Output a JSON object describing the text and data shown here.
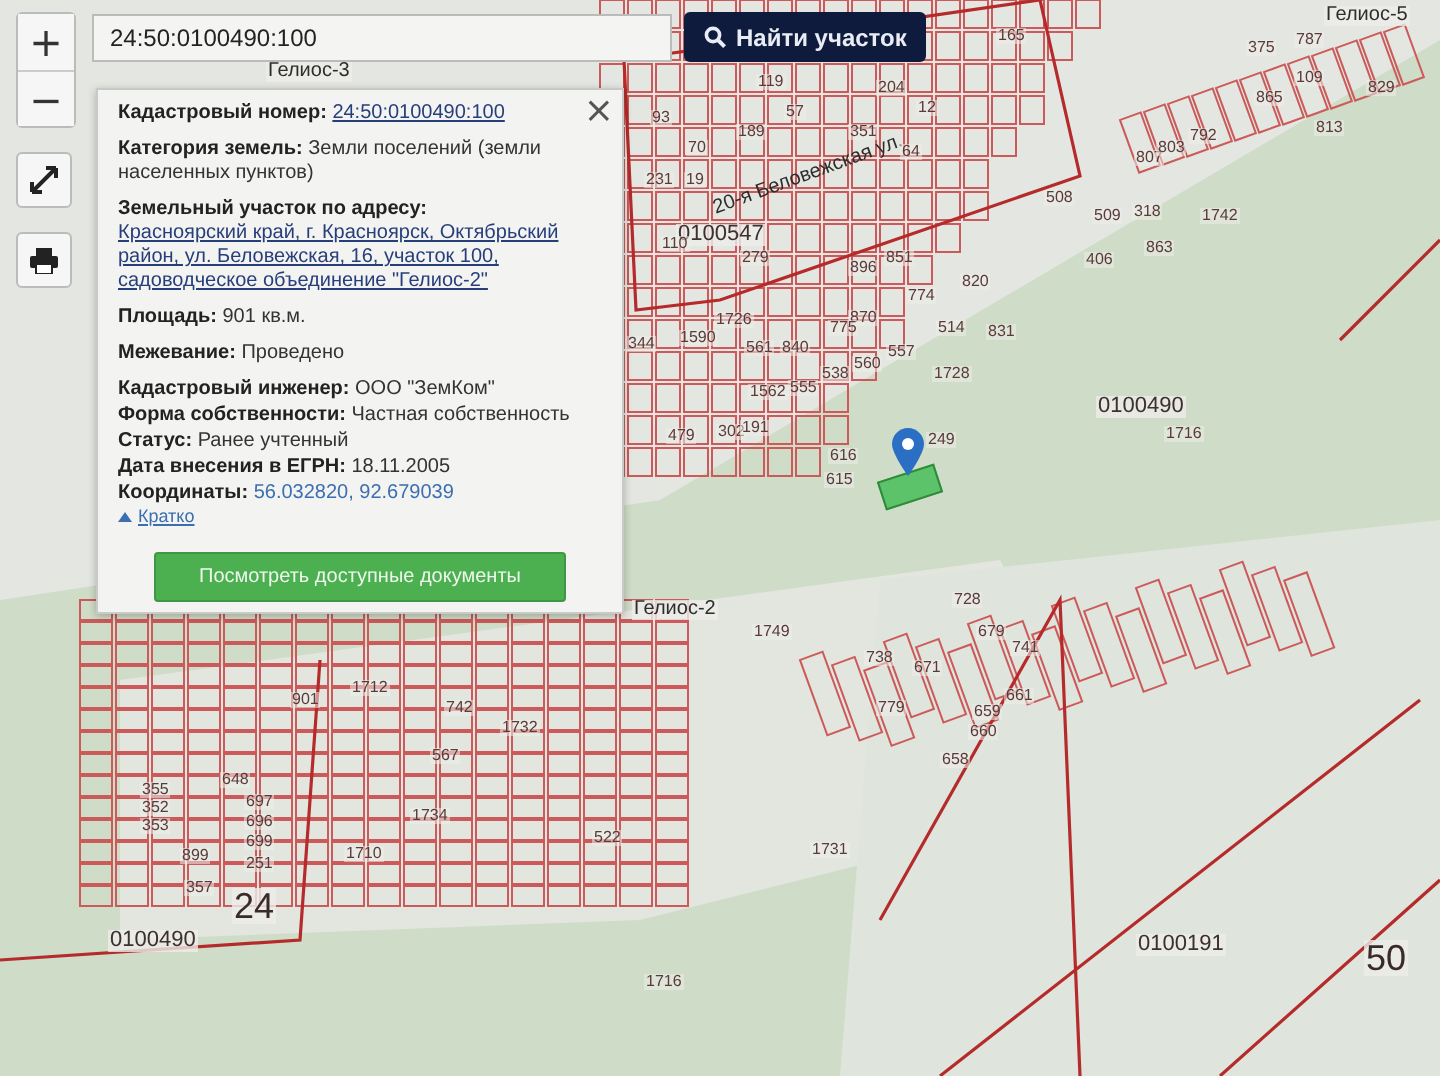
{
  "map": {
    "labels": [
      {
        "text": "Гелиос-3",
        "kind": "area"
      },
      {
        "text": "Гелиос-5",
        "kind": "area"
      },
      {
        "text": "20-я Беловежская ул.",
        "kind": "street"
      },
      {
        "text": "0100547",
        "kind": "quarter"
      },
      {
        "text": "0100490",
        "kind": "quarter"
      },
      {
        "text": "1716",
        "kind": "parcel"
      },
      {
        "text": "Гелиос-2",
        "kind": "area"
      },
      {
        "text": "24",
        "kind": "district"
      },
      {
        "text": "0100490",
        "kind": "quarter"
      },
      {
        "text": "1716",
        "kind": "parcel"
      },
      {
        "text": "0100191",
        "kind": "quarter"
      },
      {
        "text": "50",
        "kind": "district"
      },
      {
        "text": "165",
        "kind": "parcel"
      },
      {
        "text": "64",
        "kind": "parcel"
      },
      {
        "text": "508",
        "kind": "parcel"
      },
      {
        "text": "509",
        "kind": "parcel"
      },
      {
        "text": "807",
        "kind": "parcel"
      },
      {
        "text": "318",
        "kind": "parcel"
      },
      {
        "text": "803",
        "kind": "parcel"
      },
      {
        "text": "792",
        "kind": "parcel"
      },
      {
        "text": "863",
        "kind": "parcel"
      },
      {
        "text": "1742",
        "kind": "parcel"
      },
      {
        "text": "406",
        "kind": "parcel"
      },
      {
        "text": "829",
        "kind": "parcel"
      },
      {
        "text": "813",
        "kind": "parcel"
      },
      {
        "text": "865",
        "kind": "parcel"
      },
      {
        "text": "109",
        "kind": "parcel"
      },
      {
        "text": "375",
        "kind": "parcel"
      },
      {
        "text": "787",
        "kind": "parcel"
      },
      {
        "text": "514",
        "kind": "parcel"
      },
      {
        "text": "1728",
        "kind": "parcel"
      },
      {
        "text": "831",
        "kind": "parcel"
      },
      {
        "text": "774",
        "kind": "parcel"
      },
      {
        "text": "851",
        "kind": "parcel"
      },
      {
        "text": "820",
        "kind": "parcel"
      },
      {
        "text": "870",
        "kind": "parcel"
      },
      {
        "text": "775",
        "kind": "parcel"
      },
      {
        "text": "896",
        "kind": "parcel"
      },
      {
        "text": "560",
        "kind": "parcel"
      },
      {
        "text": "557",
        "kind": "parcel"
      },
      {
        "text": "538",
        "kind": "parcel"
      },
      {
        "text": "561",
        "kind": "parcel"
      },
      {
        "text": "840",
        "kind": "parcel"
      },
      {
        "text": "1562",
        "kind": "parcel"
      },
      {
        "text": "555",
        "kind": "parcel"
      },
      {
        "text": "249",
        "kind": "parcel"
      },
      {
        "text": "616",
        "kind": "parcel"
      },
      {
        "text": "615",
        "kind": "parcel"
      },
      {
        "text": "279",
        "kind": "parcel"
      },
      {
        "text": "93",
        "kind": "parcel"
      },
      {
        "text": "70",
        "kind": "parcel"
      },
      {
        "text": "231",
        "kind": "parcel"
      },
      {
        "text": "19",
        "kind": "parcel"
      },
      {
        "text": "110",
        "kind": "parcel"
      },
      {
        "text": "119",
        "kind": "parcel"
      },
      {
        "text": "189",
        "kind": "parcel"
      },
      {
        "text": "57",
        "kind": "parcel"
      },
      {
        "text": "204",
        "kind": "parcel"
      },
      {
        "text": "12",
        "kind": "parcel"
      },
      {
        "text": "351",
        "kind": "parcel"
      },
      {
        "text": "1726",
        "kind": "parcel"
      },
      {
        "text": "1590",
        "kind": "parcel"
      },
      {
        "text": "344",
        "kind": "parcel"
      },
      {
        "text": "479",
        "kind": "parcel"
      },
      {
        "text": "302",
        "kind": "parcel"
      },
      {
        "text": "191",
        "kind": "parcel"
      },
      {
        "text": "728",
        "kind": "parcel"
      },
      {
        "text": "679",
        "kind": "parcel"
      },
      {
        "text": "741",
        "kind": "parcel"
      },
      {
        "text": "738",
        "kind": "parcel"
      },
      {
        "text": "671",
        "kind": "parcel"
      },
      {
        "text": "779",
        "kind": "parcel"
      },
      {
        "text": "660",
        "kind": "parcel"
      },
      {
        "text": "659",
        "kind": "parcel"
      },
      {
        "text": "661",
        "kind": "parcel"
      },
      {
        "text": "658",
        "kind": "parcel"
      },
      {
        "text": "742",
        "kind": "parcel"
      },
      {
        "text": "1732",
        "kind": "parcel"
      },
      {
        "text": "901",
        "kind": "parcel"
      },
      {
        "text": "1712",
        "kind": "parcel"
      },
      {
        "text": "1749",
        "kind": "parcel"
      },
      {
        "text": "567",
        "kind": "parcel"
      },
      {
        "text": "1731",
        "kind": "parcel"
      },
      {
        "text": "522",
        "kind": "parcel"
      },
      {
        "text": "899",
        "kind": "parcel"
      },
      {
        "text": "697",
        "kind": "parcel"
      },
      {
        "text": "696",
        "kind": "parcel"
      },
      {
        "text": "699",
        "kind": "parcel"
      },
      {
        "text": "251",
        "kind": "parcel"
      },
      {
        "text": "355",
        "kind": "parcel"
      },
      {
        "text": "352",
        "kind": "parcel"
      },
      {
        "text": "353",
        "kind": "parcel"
      },
      {
        "text": "357",
        "kind": "parcel"
      },
      {
        "text": "648",
        "kind": "parcel"
      },
      {
        "text": "1710",
        "kind": "parcel"
      },
      {
        "text": "1734",
        "kind": "parcel"
      }
    ]
  },
  "controls": {
    "zoom_in": "+",
    "zoom_out": "−"
  },
  "search": {
    "value": "24:50:0100490:100",
    "button": "Найти участок"
  },
  "popup": {
    "close": "×",
    "sections": [
      [
        {
          "label": "Кадастровый номер:",
          "value": "24:50:0100490:100",
          "kind": "link"
        }
      ],
      [
        {
          "label": "Категория земель:",
          "value": "Земли поселений (земли населенных пунктов)",
          "kind": "plain"
        }
      ],
      [
        {
          "label": "Земельный участок по адресу:",
          "value": "Красноярский край, г. Красноярск, Октябрьский район, ул. Беловежская, 16, участок 100, садоводческое объединение \"Гелиос-2\"",
          "kind": "link"
        }
      ],
      [
        {
          "label": "Площадь:",
          "value": "901 кв.м.",
          "kind": "plain"
        }
      ],
      [
        {
          "label": "Межевание:",
          "value": "Проведено",
          "kind": "plain"
        }
      ],
      [
        {
          "label": "Кадастровый инженер:",
          "value": "ООО \"ЗемКом\"",
          "kind": "plain"
        },
        {
          "label": "Форма собственности:",
          "value": "Частная собственность",
          "kind": "plain"
        },
        {
          "label": "Статус:",
          "value": "Ранее учтенный",
          "kind": "plain"
        },
        {
          "label": "Дата внесения в ЕГРН:",
          "value": "18.11.2005",
          "kind": "plain"
        },
        {
          "label": "Координаты:",
          "value": "56.032820, 92.679039",
          "kind": "accent"
        }
      ]
    ],
    "collapse": "Кратко",
    "button": "Посмотреть доступные документы"
  }
}
